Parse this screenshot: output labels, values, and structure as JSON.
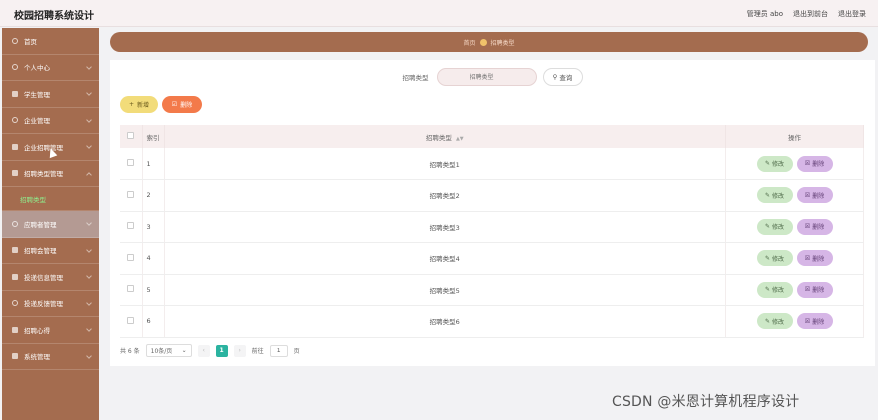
{
  "app_title": "校园招聘系统设计",
  "header": {
    "user_label": "管理员 abo",
    "back_link": "退出到前台",
    "logout_link": "退出登录"
  },
  "sidebar": {
    "items": [
      {
        "label": "首页"
      },
      {
        "label": "个人中心"
      },
      {
        "label": "学生管理"
      },
      {
        "label": "企业管理"
      },
      {
        "label": "企业招聘管理"
      },
      {
        "label": "招聘类型管理"
      },
      {
        "label": "招聘类型"
      },
      {
        "label": "应聘者管理"
      },
      {
        "label": "招聘会管理"
      },
      {
        "label": "投递信息管理"
      },
      {
        "label": "投递反馈管理"
      },
      {
        "label": "招聘心得"
      },
      {
        "label": "系统管理"
      }
    ]
  },
  "breadcrumb": {
    "home": "首页",
    "current": "招聘类型"
  },
  "search": {
    "label": "招聘类型",
    "placeholder": "招聘类型",
    "query_button": "查询"
  },
  "actions": {
    "add_label": "新增",
    "delete_label": "删除"
  },
  "table": {
    "headers": {
      "index": "索引",
      "type": "招聘类型",
      "operation": "操作"
    },
    "rows": [
      {
        "index": "1",
        "type": "招聘类型1"
      },
      {
        "index": "2",
        "type": "招聘类型2"
      },
      {
        "index": "3",
        "type": "招聘类型3"
      },
      {
        "index": "4",
        "type": "招聘类型4"
      },
      {
        "index": "5",
        "type": "招聘类型5"
      },
      {
        "index": "6",
        "type": "招聘类型6"
      }
    ],
    "edit_label": "修改",
    "delete_label": "删除"
  },
  "pagination": {
    "total_text": "共 6 条",
    "page_size": "10条/页",
    "current_page": "1",
    "goto_label": "前往",
    "goto_value": "1",
    "page_suffix": "页"
  },
  "watermark": "CSDN @米恩计算机程序设计",
  "colors": {
    "sidebar_bg": "#a46c4f",
    "active_item_bg": "#b49a93",
    "accent_green": "#2bb3a0",
    "add_button": "#f2dc7a",
    "delete_button": "#f37a4a",
    "edit_button": "#cde8c7",
    "row_delete_button": "#d6b6e6"
  }
}
